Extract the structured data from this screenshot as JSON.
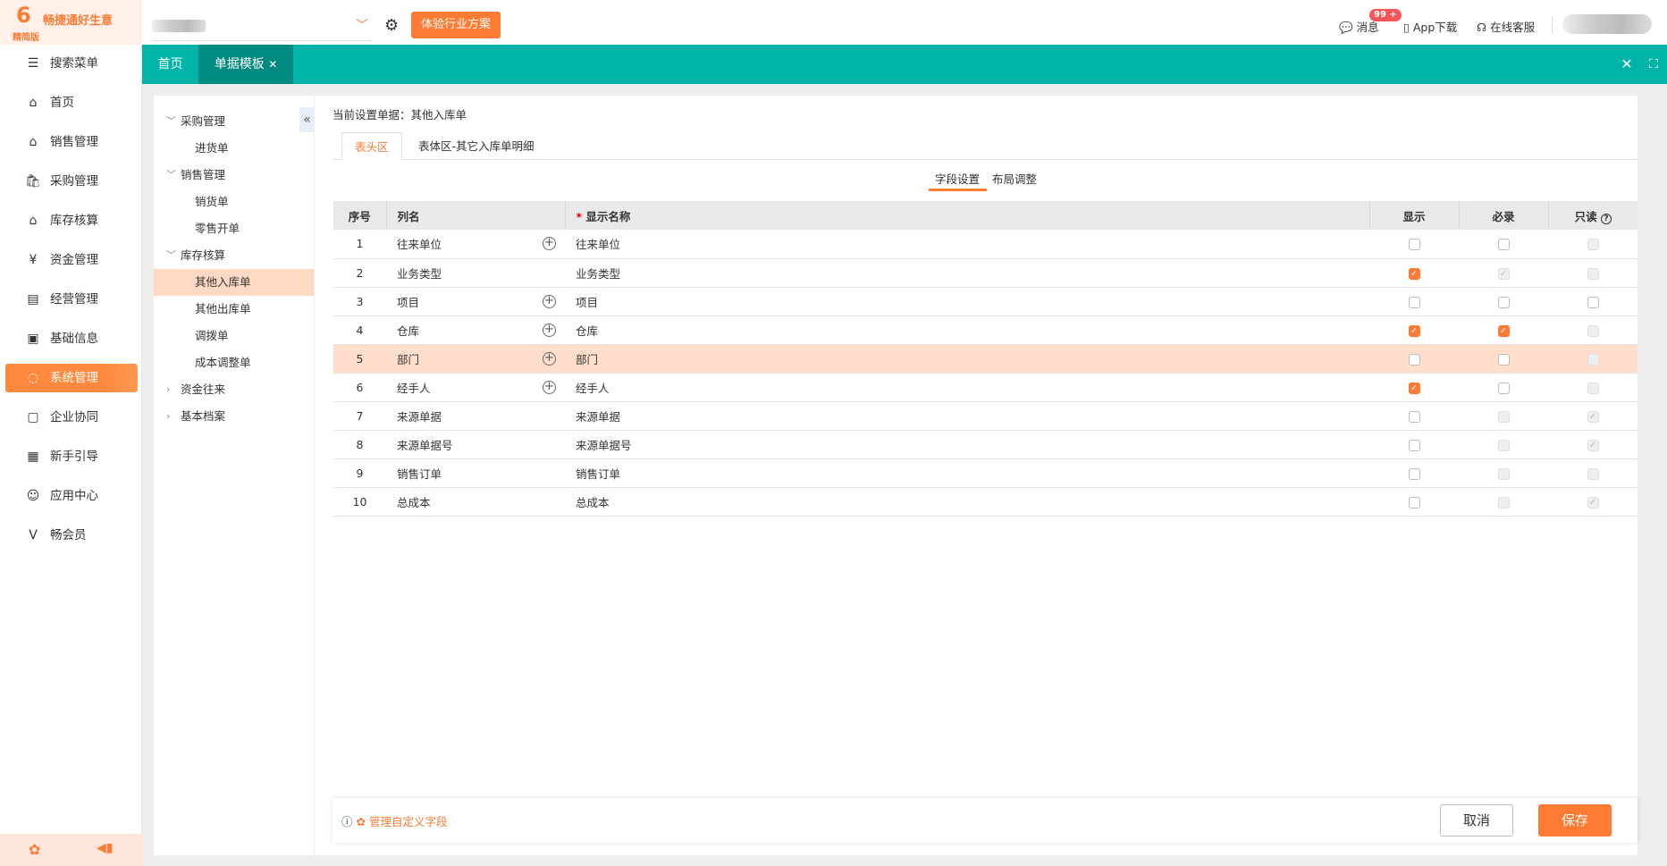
{
  "brand": {
    "name": "畅捷通好生意",
    "edition": "精简版",
    "accent": "#ff7a33",
    "teal": "#00b5a8"
  },
  "topbar": {
    "experience_button": "体验行业方案",
    "messages": "消息",
    "badge": "99 +",
    "app_download": "App下载",
    "service": "在线客服"
  },
  "tabs": [
    {
      "label": "首页"
    },
    {
      "label": "单据模板"
    }
  ],
  "sidebar": {
    "items": [
      {
        "label": "搜索菜单",
        "icon": "search-menu-icon"
      },
      {
        "label": "首页",
        "icon": "home-icon"
      },
      {
        "label": "销售管理",
        "icon": "sales-icon"
      },
      {
        "label": "采购管理",
        "icon": "bag-icon"
      },
      {
        "label": "库存核算",
        "icon": "warehouse-icon"
      },
      {
        "label": "资金管理",
        "icon": "money-bag-icon"
      },
      {
        "label": "经营管理",
        "icon": "clipboard-icon"
      },
      {
        "label": "基础信息",
        "icon": "id-card-icon"
      },
      {
        "label": "系统管理",
        "icon": "system-icon",
        "active": true
      },
      {
        "label": "企业协同",
        "icon": "collab-icon"
      },
      {
        "label": "新手引导",
        "icon": "guide-icon"
      },
      {
        "label": "应用中心",
        "icon": "app-center-icon"
      },
      {
        "label": "畅会员",
        "icon": "vip-icon"
      }
    ]
  },
  "tree": [
    {
      "label": "采购管理",
      "level": 1,
      "expanded": true
    },
    {
      "label": "进货单",
      "level": 2
    },
    {
      "label": "销售管理",
      "level": 1,
      "expanded": true
    },
    {
      "label": "销货单",
      "level": 2
    },
    {
      "label": "零售开单",
      "level": 2
    },
    {
      "label": "库存核算",
      "level": 1,
      "expanded": true
    },
    {
      "label": "其他入库单",
      "level": 2,
      "active": true
    },
    {
      "label": "其他出库单",
      "level": 2
    },
    {
      "label": "调拨单",
      "level": 2
    },
    {
      "label": "成本调整单",
      "level": 2
    },
    {
      "label": "资金往来",
      "level": 1,
      "expanded": false
    },
    {
      "label": "基本档案",
      "level": 1,
      "expanded": false
    }
  ],
  "main": {
    "current": "当前设置单据：其他入库单",
    "tabs": [
      "表头区",
      "表体区-其它入库单明细"
    ],
    "subtabs": [
      "字段设置",
      "布局调整"
    ],
    "headers": {
      "no": "序号",
      "col": "列名",
      "display_name": "显示名称",
      "show": "显示",
      "required": "必录",
      "readonly": "只读"
    },
    "rows": [
      {
        "no": "1",
        "col": "往来单位",
        "name": "往来单位",
        "plus": true,
        "show": "off",
        "req": "off",
        "ro": "dis"
      },
      {
        "no": "2",
        "col": "业务类型",
        "name": "业务类型",
        "plus": false,
        "show": "on",
        "req": "dis-on",
        "ro": "dis"
      },
      {
        "no": "3",
        "col": "项目",
        "name": "项目",
        "plus": true,
        "show": "off",
        "req": "off",
        "ro": "off"
      },
      {
        "no": "4",
        "col": "仓库",
        "name": "仓库",
        "plus": true,
        "show": "on",
        "req": "on",
        "ro": "dis"
      },
      {
        "no": "5",
        "col": "部门",
        "name": "部门",
        "plus": true,
        "show": "off",
        "req": "off",
        "ro": "dis",
        "highlight": true
      },
      {
        "no": "6",
        "col": "经手人",
        "name": "经手人",
        "plus": true,
        "show": "on",
        "req": "off",
        "ro": "dis"
      },
      {
        "no": "7",
        "col": "来源单据",
        "name": "来源单据",
        "plus": false,
        "show": "off",
        "req": "dis",
        "ro": "dis-on"
      },
      {
        "no": "8",
        "col": "来源单据号",
        "name": "来源单据号",
        "plus": false,
        "show": "off",
        "req": "dis",
        "ro": "dis-on"
      },
      {
        "no": "9",
        "col": "销售订单",
        "name": "销售订单",
        "plus": false,
        "show": "off",
        "req": "dis",
        "ro": "dis"
      },
      {
        "no": "10",
        "col": "总成本",
        "name": "总成本",
        "plus": false,
        "show": "off",
        "req": "dis",
        "ro": "dis-on"
      }
    ]
  },
  "footer": {
    "manage_link": "管理自定义字段",
    "cancel": "取消",
    "save": "保存"
  }
}
